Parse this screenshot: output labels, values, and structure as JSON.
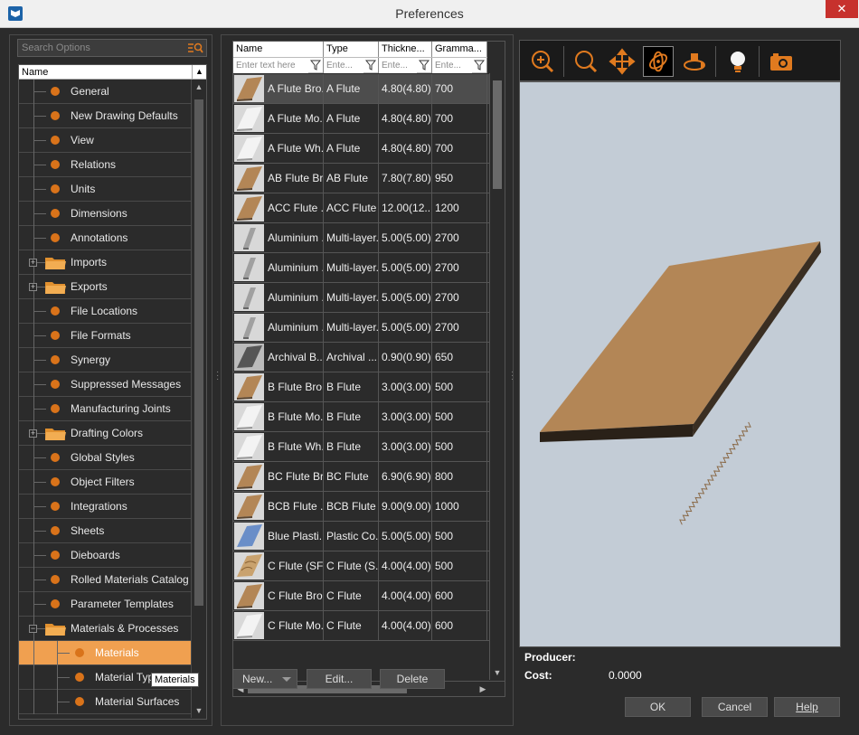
{
  "window": {
    "title": "Preferences",
    "close_label": "✕"
  },
  "left": {
    "search_placeholder": "Search Options",
    "tree_header": "Name",
    "tooltip": "Materials",
    "items": [
      {
        "label": "General",
        "type": "dot"
      },
      {
        "label": "New Drawing Defaults",
        "type": "dot"
      },
      {
        "label": "View",
        "type": "dot"
      },
      {
        "label": "Relations",
        "type": "dot"
      },
      {
        "label": "Units",
        "type": "dot"
      },
      {
        "label": "Dimensions",
        "type": "dot"
      },
      {
        "label": "Annotations",
        "type": "dot"
      },
      {
        "label": "Imports",
        "type": "folder",
        "expander": "+"
      },
      {
        "label": "Exports",
        "type": "folder",
        "expander": "+"
      },
      {
        "label": "File Locations",
        "type": "dot"
      },
      {
        "label": "File Formats",
        "type": "dot"
      },
      {
        "label": "Synergy",
        "type": "dot"
      },
      {
        "label": "Suppressed Messages",
        "type": "dot"
      },
      {
        "label": "Manufacturing Joints",
        "type": "dot"
      },
      {
        "label": "Drafting Colors",
        "type": "folder",
        "expander": "+"
      },
      {
        "label": "Global Styles",
        "type": "dot"
      },
      {
        "label": "Object Filters",
        "type": "dot"
      },
      {
        "label": "Integrations",
        "type": "dot"
      },
      {
        "label": "Sheets",
        "type": "dot"
      },
      {
        "label": "Dieboards",
        "type": "dot"
      },
      {
        "label": "Rolled Materials Catalog",
        "type": "dot"
      },
      {
        "label": "Parameter Templates",
        "type": "dot"
      },
      {
        "label": "Materials & Processes",
        "type": "folder",
        "expander": "−"
      },
      {
        "label": "Materials",
        "type": "child",
        "selected": true
      },
      {
        "label": "Material Types",
        "type": "child"
      },
      {
        "label": "Material Surfaces",
        "type": "child"
      }
    ]
  },
  "grid": {
    "columns": [
      "Name",
      "Type",
      "Thickne...",
      "Gramma..."
    ],
    "filters": [
      "Enter text here",
      "Ente...",
      "Ente...",
      "Ente..."
    ],
    "rows": [
      {
        "name": "A Flute Bro...",
        "type": "A Flute",
        "thickness": "4.80(4.80)",
        "grammage": "700",
        "thumb": "brown",
        "selected": true
      },
      {
        "name": "A Flute Mo...",
        "type": "A Flute",
        "thickness": "4.80(4.80)",
        "grammage": "700",
        "thumb": "white"
      },
      {
        "name": "A Flute Wh...",
        "type": "A Flute",
        "thickness": "4.80(4.80)",
        "grammage": "700",
        "thumb": "white"
      },
      {
        "name": "AB Flute Br...",
        "type": "AB Flute",
        "thickness": "7.80(7.80)",
        "grammage": "950",
        "thumb": "brown"
      },
      {
        "name": "ACC Flute ...",
        "type": "ACC Flute",
        "thickness": "12.00(12....",
        "grammage": "1200",
        "thumb": "brown"
      },
      {
        "name": "Aluminium ...",
        "type": "Multi-layer...",
        "thickness": "5.00(5.00)",
        "grammage": "2700",
        "thumb": "metal"
      },
      {
        "name": "Aluminium ...",
        "type": "Multi-layer...",
        "thickness": "5.00(5.00)",
        "grammage": "2700",
        "thumb": "metal"
      },
      {
        "name": "Aluminium ...",
        "type": "Multi-layer...",
        "thickness": "5.00(5.00)",
        "grammage": "2700",
        "thumb": "metal"
      },
      {
        "name": "Aluminium ...",
        "type": "Multi-layer...",
        "thickness": "5.00(5.00)",
        "grammage": "2700",
        "thumb": "metal"
      },
      {
        "name": "Archival B...",
        "type": "Archival ...",
        "thickness": "0.90(0.90)",
        "grammage": "650",
        "thumb": "dark"
      },
      {
        "name": "B Flute Bro...",
        "type": "B Flute",
        "thickness": "3.00(3.00)",
        "grammage": "500",
        "thumb": "brown"
      },
      {
        "name": "B Flute Mo...",
        "type": "B Flute",
        "thickness": "3.00(3.00)",
        "grammage": "500",
        "thumb": "white"
      },
      {
        "name": "B Flute Wh...",
        "type": "B Flute",
        "thickness": "3.00(3.00)",
        "grammage": "500",
        "thumb": "white"
      },
      {
        "name": "BC Flute Br...",
        "type": "BC Flute",
        "thickness": "6.90(6.90)",
        "grammage": "800",
        "thumb": "brown"
      },
      {
        "name": "BCB Flute ...",
        "type": "BCB Flute",
        "thickness": "9.00(9.00)",
        "grammage": "1000",
        "thumb": "brown"
      },
      {
        "name": "Blue Plasti...",
        "type": "Plastic Co...",
        "thickness": "5.00(5.00)",
        "grammage": "500",
        "thumb": "blue"
      },
      {
        "name": "C Flute (SFB)",
        "type": "C Flute (S...",
        "thickness": "4.00(4.00)",
        "grammage": "500",
        "thumb": "wood"
      },
      {
        "name": "C Flute Bro...",
        "type": "C Flute",
        "thickness": "4.00(4.00)",
        "grammage": "600",
        "thumb": "brown"
      },
      {
        "name": "C Flute Mo...",
        "type": "C Flute",
        "thickness": "4.00(4.00)",
        "grammage": "600",
        "thumb": "white"
      }
    ]
  },
  "buttons": {
    "new": "New...",
    "edit": "Edit...",
    "delete": "Delete",
    "ok": "OK",
    "cancel": "Cancel",
    "help": "Help"
  },
  "viewer": {
    "tools": [
      "zoom-fit-icon",
      "zoom-icon",
      "pan-icon",
      "rotate-icon",
      "orbit-icon",
      "light-icon",
      "camera-icon"
    ],
    "accent": "#e07a1f",
    "background": "#c3ccd6",
    "board_color": "#b38656"
  },
  "properties": {
    "producer_label": "Producer:",
    "producer_value": "",
    "cost_label": "Cost:",
    "cost_value": "0.0000"
  }
}
